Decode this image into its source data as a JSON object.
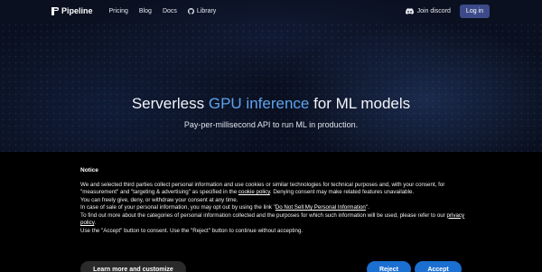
{
  "nav": {
    "logo_text": "Pipeline",
    "links": [
      "Pricing",
      "Blog",
      "Docs",
      "Library"
    ],
    "discord_label": "Join discord",
    "login_label": "Log in"
  },
  "hero": {
    "title_pre": "Serverless ",
    "title_accent": "GPU inference",
    "title_post": " for ML models",
    "subtitle": "Pay-per-millisecond API to run ML in production."
  },
  "cookie": {
    "title": "Notice",
    "p1_a": "We and selected third parties collect personal information and use cookies or similar technologies for technical purposes and, with your consent, for \"measurement\" and \"targeting & advertising\" as specified in the ",
    "p1_link": "cookie policy",
    "p1_b": ". Denying consent may make related features unavailable.",
    "p2": "You can freely give, deny, or withdraw your consent at any time.",
    "p3_a": "In case of sale of your personal information, you may opt out by using the link \"",
    "p3_link": "Do Not Sell My Personal Information",
    "p3_b": "\".",
    "p4_a": "To find out more about the categories of personal information collected and the purposes for which such information will be used, please refer to our ",
    "p4_link": "privacy policy",
    "p4_b": ".",
    "p5": "Use the \"Accept\" button to consent. Use the \"Reject\" button to continue without accepting.",
    "learn_label": "Learn more and customize",
    "reject_label": "Reject",
    "accept_label": "Accept"
  },
  "colors": {
    "accent": "#5ea3ec",
    "button_blue": "#1a6fd1",
    "login_bg": "#3c4a8a"
  }
}
